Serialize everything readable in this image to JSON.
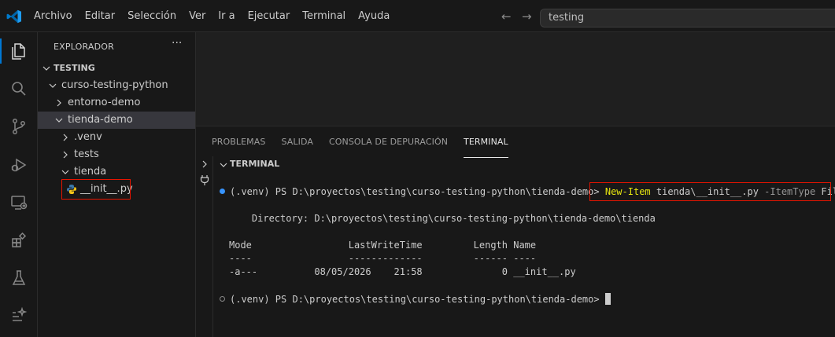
{
  "menubar": {
    "items": [
      "Archivo",
      "Editar",
      "Selección",
      "Ver",
      "Ir a",
      "Ejecutar",
      "Terminal",
      "Ayuda"
    ]
  },
  "title_search": {
    "text": "testing"
  },
  "colors": {
    "accent": "#0078d4",
    "highlight_border": "#e51400",
    "terminal_yellow": "#e5e510",
    "prompt_dot": "#3794ff"
  },
  "activity_icons": [
    "explorer-icon",
    "search-icon",
    "source-control-icon",
    "run-debug-icon",
    "remote-explorer-icon",
    "extensions-icon",
    "testing-icon",
    "chat-icon"
  ],
  "sidebar": {
    "title": "EXPLORADOR",
    "more": "···",
    "tree": [
      {
        "label": "TESTING",
        "level": 0,
        "chevron": "down",
        "section": true
      },
      {
        "label": "curso-testing-python",
        "level": 1,
        "chevron": "down"
      },
      {
        "label": "entorno-demo",
        "level": 2,
        "chevron": "right"
      },
      {
        "label": "tienda-demo",
        "level": 2,
        "chevron": "down",
        "selected": true
      },
      {
        "label": ".venv",
        "level": 3,
        "chevron": "right"
      },
      {
        "label": "tests",
        "level": 3,
        "chevron": "right"
      },
      {
        "label": "tienda",
        "level": 3,
        "chevron": "down"
      },
      {
        "label": "__init__.py",
        "level": 4,
        "file": "python"
      }
    ]
  },
  "panel": {
    "tabs": [
      "PROBLEMAS",
      "SALIDA",
      "CONSOLA DE DEPURACIÓN",
      "TERMINAL"
    ],
    "active_tab": "TERMINAL",
    "terminal_label": "TERMINAL"
  },
  "terminal": {
    "prompt": "(.venv) PS D:\\proyectos\\testing\\curso-testing-python\\tienda-demo>",
    "cmd_name": "New-Item",
    "cmd_arg": "tienda\\__init__.py",
    "cmd_param": "-ItemType",
    "cmd_value": "File",
    "directory_line": "    Directory: D:\\proyectos\\testing\\curso-testing-python\\tienda-demo\\tienda",
    "header_line": "Mode                 LastWriteTime         Length Name",
    "separator_line": "----                 -------------         ------ ----",
    "row_line": "-a---          08/05/2026    21:58              0 __init__.py",
    "prompt2": "(.venv) PS D:\\proyectos\\testing\\curso-testing-python\\tienda-demo>"
  }
}
